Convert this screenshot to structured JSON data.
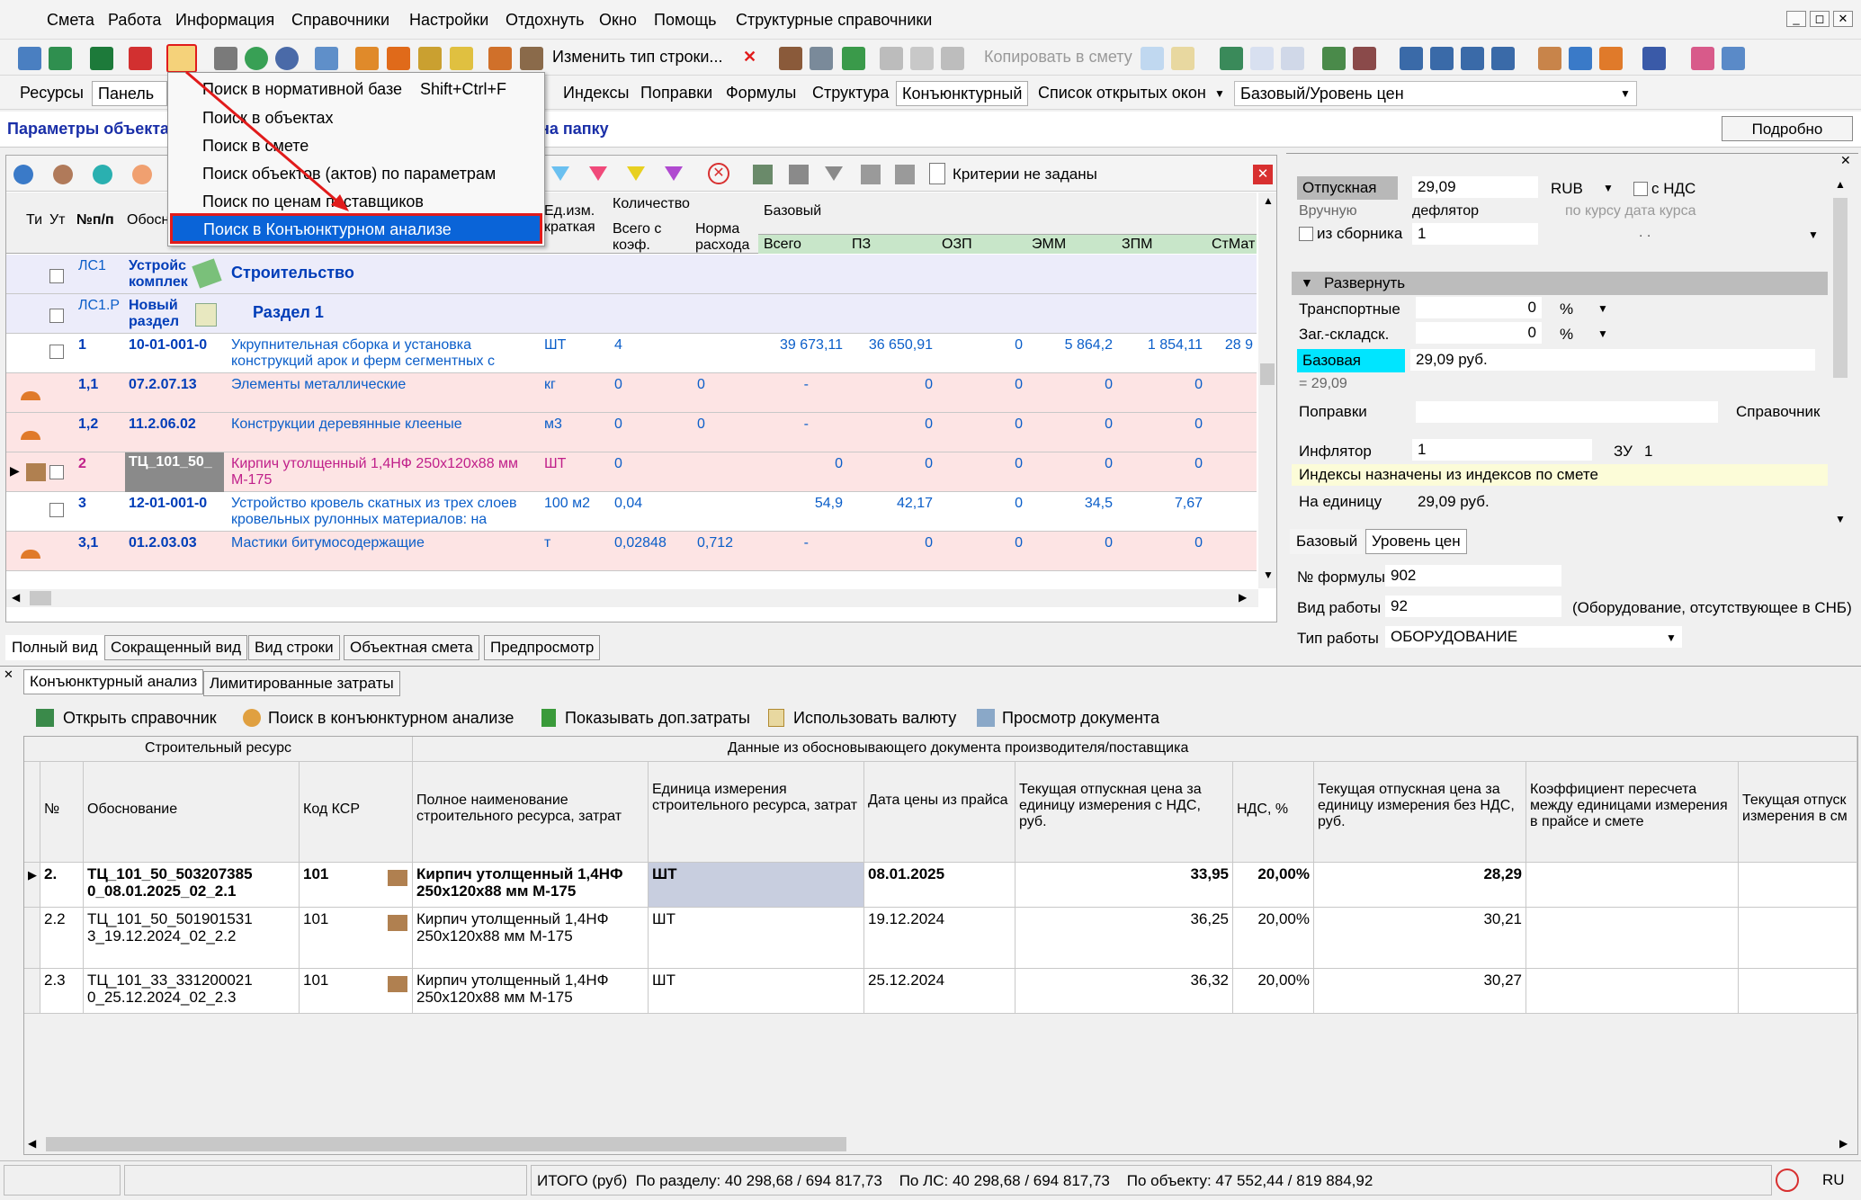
{
  "menu": {
    "items": [
      "Смета",
      "Работа",
      "Информация",
      "Справочники",
      "Настройки",
      "Отдохнуть",
      "Окно",
      "Помощь",
      "Структурные справочники"
    ],
    "win_minimize": "_",
    "win_restore": "◻",
    "win_close": "✕"
  },
  "toolbar": {
    "change_row_type": "Изменить тип строки...",
    "copy_to_estimate": "Копировать в смету"
  },
  "tabs2": {
    "resources": "Ресурсы",
    "panel": "Панель",
    "indexes": "Индексы",
    "corrections": "Поправки",
    "formulas": "Формулы",
    "structure": "Структура",
    "conjuncture": "Конъюнктурный",
    "open_windows": "Список открытых окон",
    "level_combo": "Базовый/Уровень цен"
  },
  "infobar": {
    "left_text": "Параметры объекта",
    "right_text": "на папку",
    "details_button": "Подробно"
  },
  "dropdown": {
    "items": [
      {
        "label": "Поиск в нормативной базе",
        "shortcut": "Shift+Ctrl+F"
      },
      {
        "label": "Поиск в объектах",
        "shortcut": ""
      },
      {
        "label": "Поиск в смете",
        "shortcut": ""
      },
      {
        "label": "Поиск объектов (актов) по параметрам",
        "shortcut": ""
      },
      {
        "label": "Поиск по ценам поставщиков",
        "shortcut": ""
      },
      {
        "label": "Поиск в Конъюнктурном анализе",
        "shortcut": ""
      }
    ]
  },
  "grid": {
    "criteria": "Критерии не заданы",
    "headers": {
      "ti": "Ти",
      "ut": "Ут",
      "npp": "№п/п",
      "obos": "Обосн",
      "unit": "Ед.изм. краткая",
      "qty_group": "Количество",
      "qty_total": "Всего с коэф.",
      "qty_norm": "Норма расхода",
      "base_group": "Базовый",
      "total": "Всего",
      "pz": "ПЗ",
      "ozp": "ОЗП",
      "emm": "ЭММ",
      "zpm": "ЗПМ",
      "stmat": "СтМат"
    },
    "rows": [
      {
        "num": "ЛС1",
        "code": "Устройс комплек",
        "name": "Строительство",
        "unit": "",
        "qty": "",
        "norm": "",
        "total": "",
        "pz": "",
        "ozp": "",
        "emm": "",
        "zpm": "",
        "stmat": ""
      },
      {
        "num": "ЛС1.Р",
        "code": "Новый раздел",
        "name": "Раздел 1",
        "unit": "",
        "qty": "",
        "norm": "",
        "total": "",
        "pz": "",
        "ozp": "",
        "emm": "",
        "zpm": "",
        "stmat": ""
      },
      {
        "num": "1",
        "code": "10-01-001-0",
        "name": "Укрупнительная сборка и установка конструкций арок и ферм сегментных с",
        "unit": "ШТ",
        "qty": "4",
        "norm": "",
        "total": "39 673,11",
        "pz": "36 650,91",
        "ozp": "0",
        "emm": "5 864,2",
        "zpm": "1 854,11",
        "stmat": "28 9"
      },
      {
        "num": "1,1",
        "code": "07.2.07.13",
        "name": "Элементы металлические",
        "unit": "кг",
        "qty": "0",
        "norm": "0",
        "total": "-",
        "pz": "0",
        "ozp": "0",
        "emm": "0",
        "zpm": "0",
        "stmat": ""
      },
      {
        "num": "1,2",
        "code": "11.2.06.02",
        "name": "Конструкции деревянные клееные",
        "unit": "м3",
        "qty": "0",
        "norm": "0",
        "total": "-",
        "pz": "0",
        "ozp": "0",
        "emm": "0",
        "zpm": "0",
        "stmat": ""
      },
      {
        "num": "2",
        "code": "ТЦ_101_50_",
        "name": "Кирпич утолщенный 1,4НФ 250x120x88 мм М-175",
        "unit": "ШТ",
        "qty": "0",
        "norm": "",
        "total": "0",
        "pz": "0",
        "ozp": "0",
        "emm": "0",
        "zpm": "0",
        "stmat": ""
      },
      {
        "num": "3",
        "code": "12-01-001-0",
        "name": "Устройство кровель скатных из трех слоев кровельных рулонных материалов: на",
        "unit": "100 м2",
        "qty": "0,04",
        "norm": "",
        "total": "54,9",
        "pz": "42,17",
        "ozp": "0",
        "emm": "34,5",
        "zpm": "7,67",
        "stmat": ""
      },
      {
        "num": "3,1",
        "code": "01.2.03.03",
        "name": "Мастики битумосодержащие",
        "unit": "т",
        "qty": "0,02848",
        "norm": "0,712",
        "total": "-",
        "pz": "0",
        "ozp": "0",
        "emm": "0",
        "zpm": "0",
        "stmat": ""
      }
    ],
    "view_tabs": [
      "Полный вид",
      "Сокращенный вид",
      "Вид строки",
      "Объектная смета",
      "Предпросмотр"
    ]
  },
  "right_panel": {
    "price_type": "Отпускная",
    "price_value": "29,09",
    "currency": "RUB",
    "with_vat": "с НДС",
    "manual": "Вручную",
    "deflator": "дефлятор",
    "by_rate": "по курсу дата курса",
    "from_collection": "из сборника",
    "collection_value": "1",
    "dots": ". .",
    "expand": "Развернуть",
    "transport": "Транспортные",
    "transport_val": "0",
    "warehouse": "Заг.-складск.",
    "warehouse_val": "0",
    "percent": "%",
    "base": "Базовая",
    "base_val": "29,09 руб.",
    "eq": "= 29,09",
    "corrections": "Поправки",
    "reference": "Справочник",
    "inflator": "Инфлятор",
    "inflator_val": "1",
    "zu": "ЗУ",
    "zu_val": "1",
    "indexes_note": "Индексы назначены из индексов по смете",
    "per_unit": "На единицу",
    "per_unit_val": "29,09 руб.",
    "tab_base": "Базовый",
    "tab_level": "Уровень цен",
    "formula_no": "№ формулы",
    "formula_val": "902",
    "work_kind": "Вид работы",
    "work_kind_val": "92",
    "work_kind_note": "(Оборудование, отсутствующее в СНБ)",
    "work_type": "Тип работы",
    "work_type_val": "ОБОРУДОВАНИЕ"
  },
  "bottom": {
    "tab_conj": "Конъюнктурный анализ",
    "tab_limited": "Лимитированные затраты",
    "btn_open": "Открыть справочник",
    "btn_search": "Поиск в конъюнктурном анализе",
    "btn_extra": "Показывать доп.затраты",
    "btn_currency": "Использовать валюту",
    "btn_view": "Просмотр документа",
    "grp_resource": "Строительный ресурс",
    "grp_doc": "Данные из обосновывающего документа производителя/поставщика",
    "h_no": "№",
    "h_just": "Обоснование",
    "h_ksr": "Код КСР",
    "h_fullname": "Полное наименование строительного ресурса, затрат",
    "h_unit": "Единица измерения строительного ресурса, затрат",
    "h_date": "Дата цены из прайса",
    "h_price_vat": "Текущая отпускная цена за единицу измерения с НДС, руб.",
    "h_vat": "НДС, %",
    "h_price_novat": "Текущая отпускная цена за единицу измерения без НДС, руб.",
    "h_coef": "Коэффициент пересчета между единицами измерения в прайсе и смете",
    "h_cur": "Текущая отпуск измерения в см",
    "rows": [
      {
        "no": "2.",
        "just": "ТЦ_101_50_503207385 0_08.01.2025_02_2.1",
        "ksr": "101",
        "name": "Кирпич утолщенный 1,4НФ 250x120x88 мм М-175",
        "unit": "ШТ",
        "date": "08.01.2025",
        "pvat": "33,95",
        "vat": "20,00%",
        "pnovat": "28,29"
      },
      {
        "no": "2.2",
        "just": "ТЦ_101_50_501901531 3_19.12.2024_02_2.2",
        "ksr": "101",
        "name": "Кирпич утолщенный 1,4НФ 250x120x88 мм М-175",
        "unit": "ШТ",
        "date": "19.12.2024",
        "pvat": "36,25",
        "vat": "20,00%",
        "pnovat": "30,21"
      },
      {
        "no": "2.3",
        "just": "ТЦ_101_33_331200021 0_25.12.2024_02_2.3",
        "ksr": "101",
        "name": "Кирпич утолщенный 1,4НФ 250x120x88 мм М-175",
        "unit": "ШТ",
        "date": "25.12.2024",
        "pvat": "36,32",
        "vat": "20,00%",
        "pnovat": "30,27"
      }
    ]
  },
  "status": {
    "totals": "ИТОГО (руб)  По разделу: 40 298,68 / 694 817,73    По ЛС: 40 298,68 / 694 817,73    По объекту: 47 552,44 / 819 884,92",
    "lang": "RU"
  },
  "colors": {
    "accent_red": "#e11b1b",
    "selection_blue": "#0a64d8",
    "pink_row": "#fde4e4",
    "lavender_row": "#ececfa",
    "green_header": "#c8e6c9",
    "cyan_base": "#00e5ff",
    "blue_link": "#0b5ec9"
  }
}
